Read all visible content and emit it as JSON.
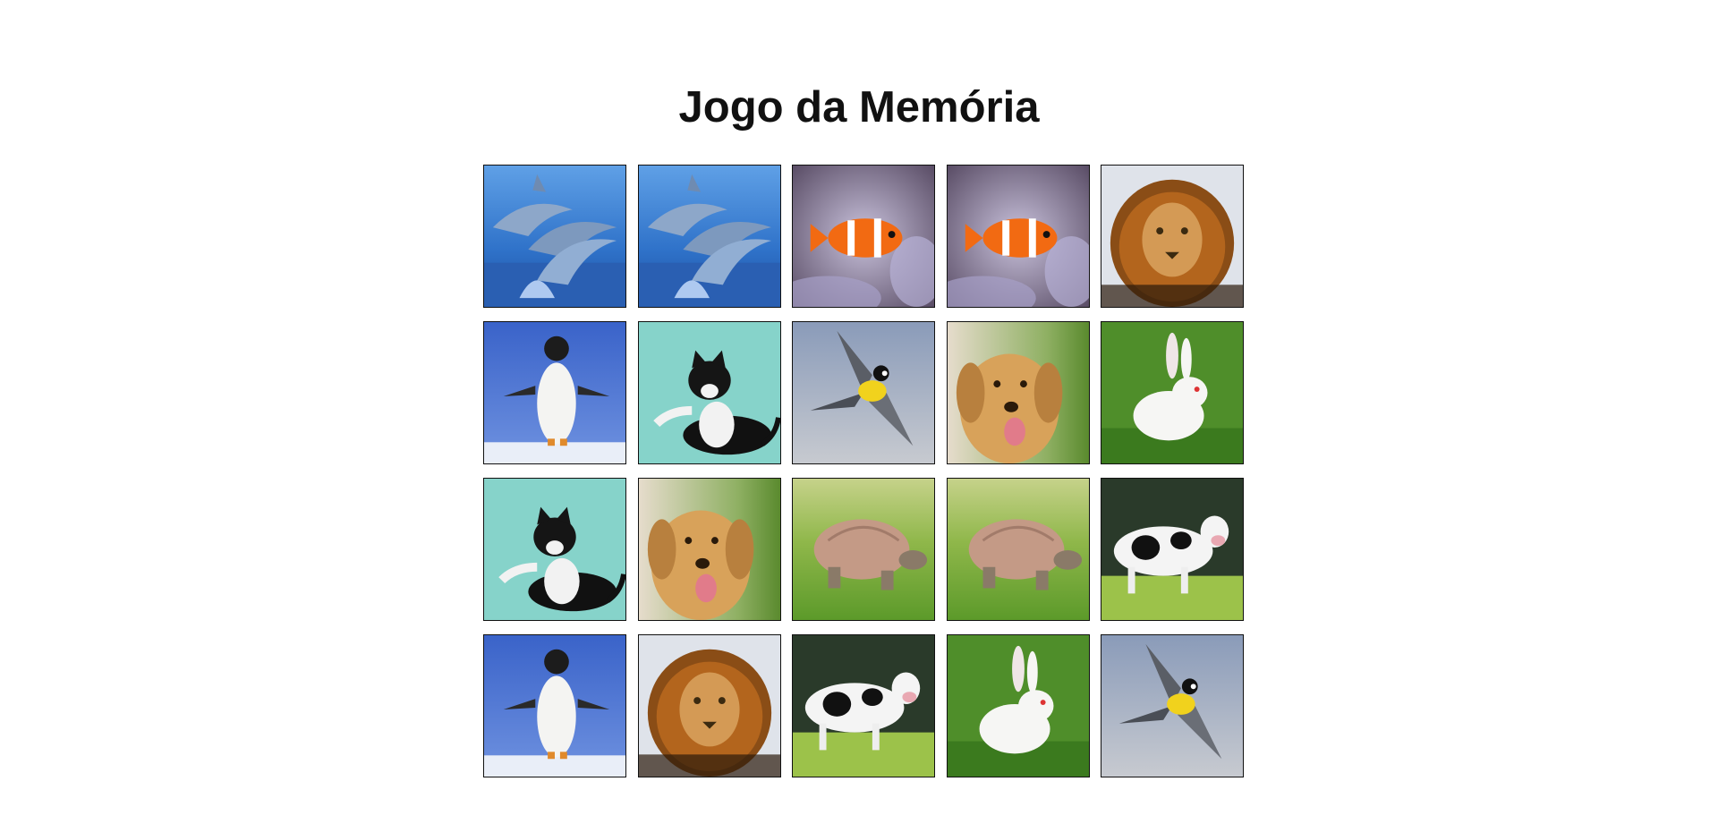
{
  "title": "Jogo da Memória",
  "board": {
    "columns": 5,
    "cards": [
      {
        "animal": "dolphins",
        "state": "revealed"
      },
      {
        "animal": "dolphins",
        "state": "revealed"
      },
      {
        "animal": "clownfish",
        "state": "revealed"
      },
      {
        "animal": "clownfish",
        "state": "revealed"
      },
      {
        "animal": "lion",
        "state": "revealed"
      },
      {
        "animal": "penguin",
        "state": "revealed"
      },
      {
        "animal": "cat",
        "state": "revealed"
      },
      {
        "animal": "bird",
        "state": "revealed"
      },
      {
        "animal": "dog",
        "state": "revealed"
      },
      {
        "animal": "rabbit",
        "state": "revealed"
      },
      {
        "animal": "cat",
        "state": "revealed"
      },
      {
        "animal": "dog",
        "state": "revealed"
      },
      {
        "animal": "tortoise",
        "state": "revealed"
      },
      {
        "animal": "tortoise",
        "state": "revealed"
      },
      {
        "animal": "cow",
        "state": "revealed"
      },
      {
        "animal": "penguin",
        "state": "revealed"
      },
      {
        "animal": "lion",
        "state": "revealed"
      },
      {
        "animal": "cow",
        "state": "revealed"
      },
      {
        "animal": "rabbit",
        "state": "revealed"
      },
      {
        "animal": "bird",
        "state": "revealed"
      }
    ]
  },
  "colors": {
    "title": "#111111",
    "card_border": "#111111",
    "background": "#ffffff"
  }
}
